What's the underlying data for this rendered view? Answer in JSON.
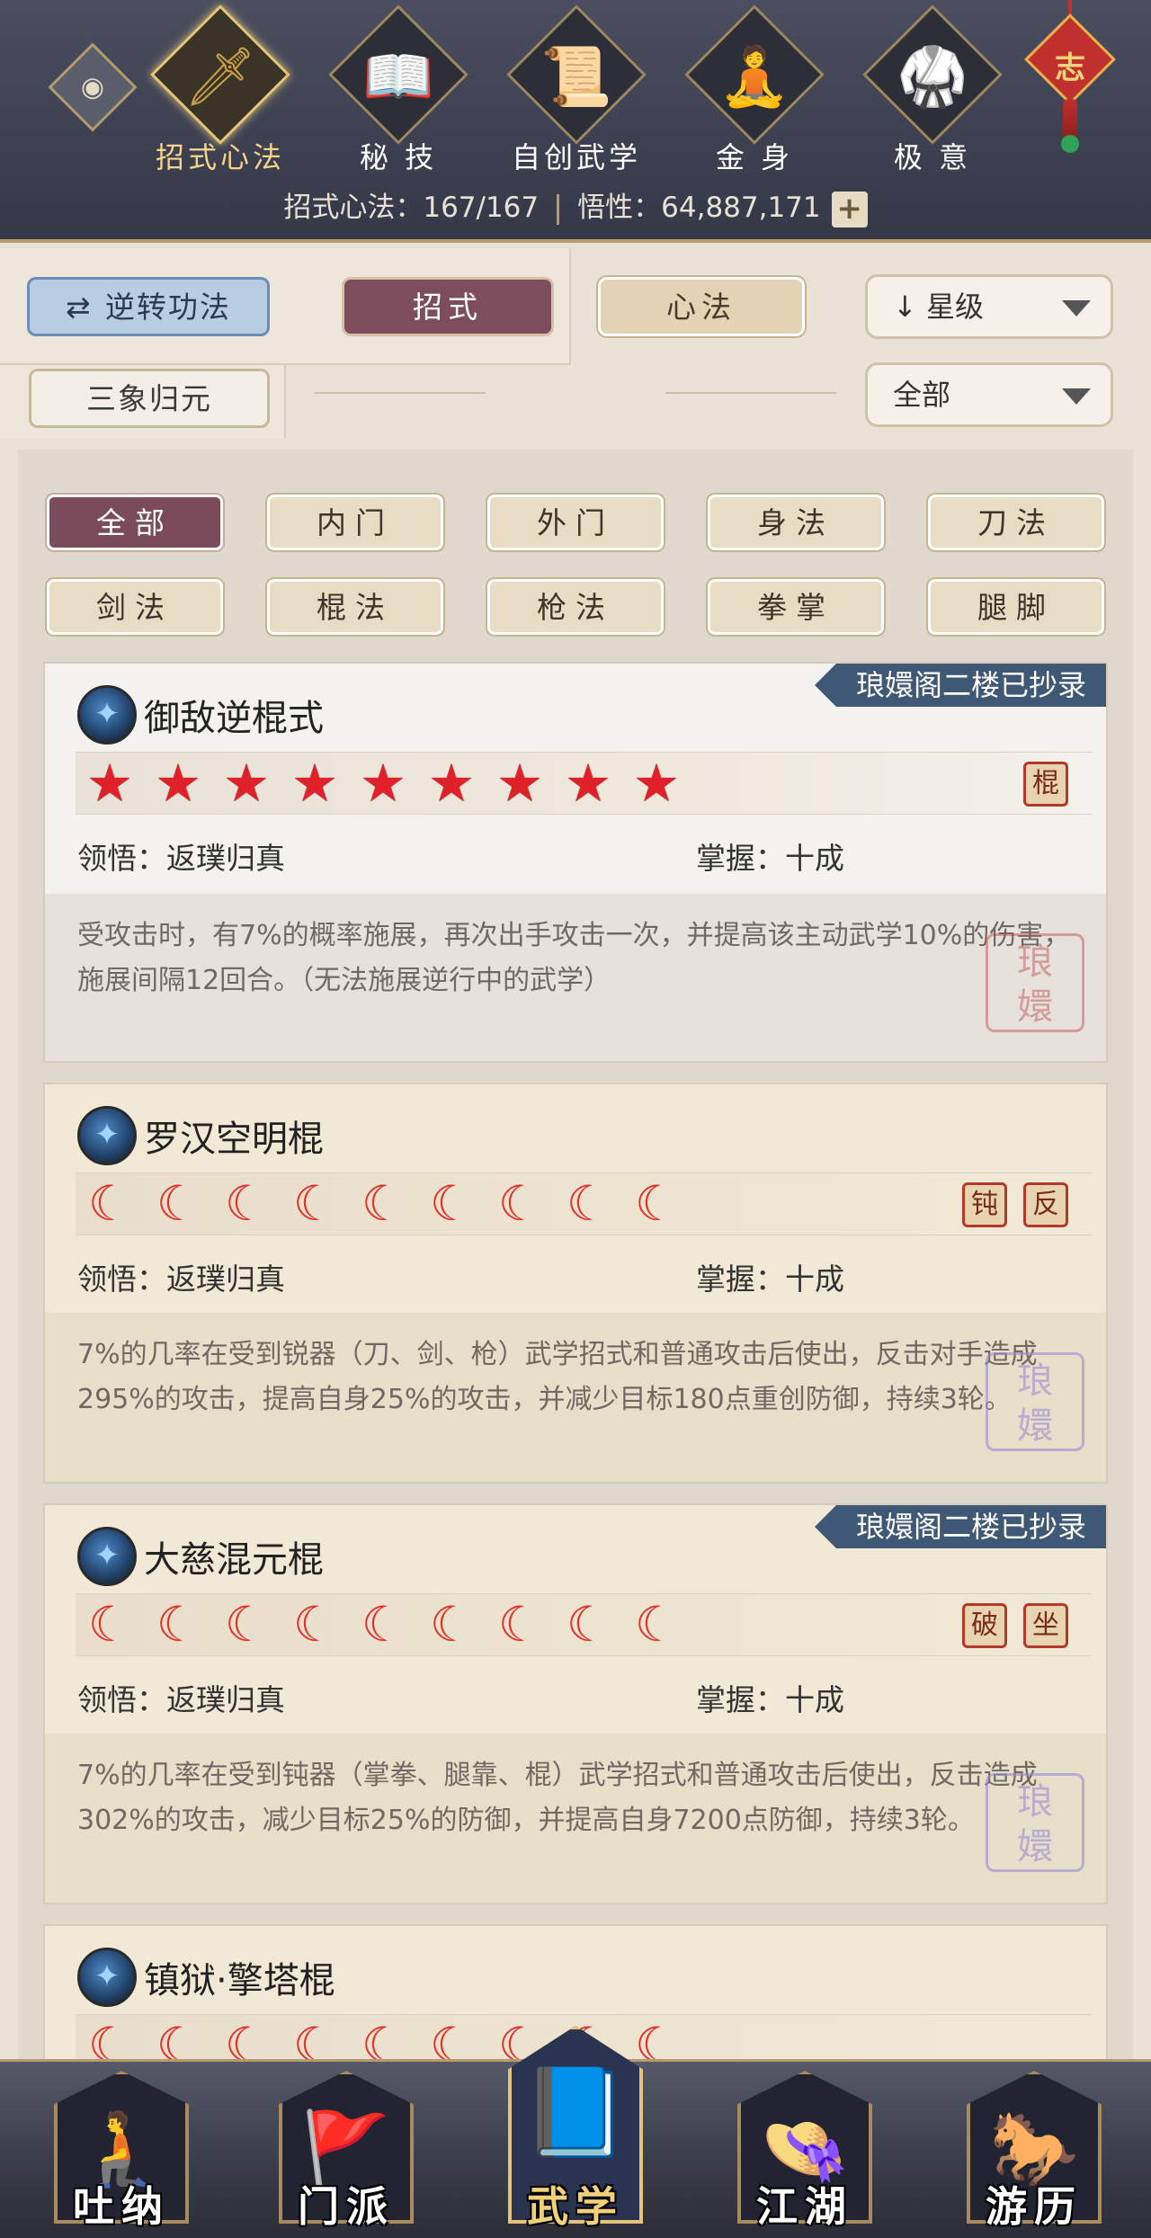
{
  "top_nav": {
    "items": [
      {
        "label": "招式心法",
        "icon": "sword-icon",
        "glyph": "🗡",
        "active": true
      },
      {
        "label": "秘 技",
        "icon": "book-icon",
        "glyph": "📖",
        "active": false
      },
      {
        "label": "自创武学",
        "icon": "scroll-icon",
        "glyph": "📜",
        "active": false
      },
      {
        "label": "金 身",
        "icon": "meditation-icon",
        "glyph": "🧘",
        "active": false
      },
      {
        "label": "极 意",
        "icon": "martial-stance-icon",
        "glyph": "🥋",
        "active": false
      }
    ],
    "charm_text": "志"
  },
  "stats": {
    "moves_label": "招式心法：167/167",
    "insight_label": "悟性：64,887,171",
    "plus": "+"
  },
  "filters": {
    "reverse_button": "逆转功法",
    "reverse_glyph": "⇄",
    "tab_moves": "招式",
    "tab_heart": "心法",
    "sort_dropdown": "↓ 星级",
    "sanxiang_button": "三象归元",
    "scope_dropdown": "全部"
  },
  "categories": [
    "全部",
    "内门",
    "外门",
    "身法",
    "刀法",
    "剑法",
    "棍法",
    "枪法",
    "拳掌",
    "腿脚"
  ],
  "active_category": "全部",
  "cards": [
    {
      "name": "御敌逆棍式",
      "ribbon": "琅嬛阁二楼已抄录",
      "stars": 9,
      "star_type": "star",
      "badges": [
        "棍"
      ],
      "insight": "领悟：返璞归真",
      "mastery": "掌握：十成",
      "desc": "受攻击时，有7%的概率施展，再次出手攻击一次，并提高该主动武学10%的伤害，施展间隔12回合。（无法施展逆行中的武学）"
    },
    {
      "name": "罗汉空明棍",
      "ribbon": "",
      "stars": 9,
      "star_type": "flame",
      "badges": [
        "钝",
        "反"
      ],
      "insight": "领悟：返璞归真",
      "mastery": "掌握：十成",
      "desc": "7%的几率在受到锐器（刀、剑、枪）武学招式和普通攻击后使出，反击对手造成295%的攻击，提高自身25%的攻击，并减少目标180点重创防御，持续3轮。"
    },
    {
      "name": "大慈混元棍",
      "ribbon": "琅嬛阁二楼已抄录",
      "stars": 9,
      "star_type": "flame",
      "badges": [
        "破",
        "坐"
      ],
      "insight": "领悟：返璞归真",
      "mastery": "掌握：十成",
      "desc": "7%的几率在受到钝器（掌拳、腿靠、棍）武学招式和普通攻击后使出，反击造成302%的攻击，减少目标25%的防御，并提高自身7200点防御，持续3轮。"
    },
    {
      "name": "镇狱·擎塔棍",
      "ribbon": "",
      "stars": 9,
      "star_type": "flame",
      "badges": [],
      "insight": "",
      "mastery": "",
      "desc": ""
    }
  ],
  "bottom_nav": {
    "items": [
      {
        "label": "吐纳",
        "icon": "monk-icon",
        "glyph": "🧎",
        "active": false
      },
      {
        "label": "门派",
        "icon": "banner-icon",
        "glyph": "🚩",
        "active": false
      },
      {
        "label": "武学",
        "icon": "manual-icon",
        "glyph": "📘",
        "active": true
      },
      {
        "label": "江湖",
        "icon": "straw-hat-icon",
        "glyph": "👒",
        "active": false
      },
      {
        "label": "游历",
        "icon": "horse-icon",
        "glyph": "🐎",
        "active": false
      }
    ]
  },
  "colors": {
    "topbar": "#3c4050",
    "accent_gold": "#e3c47a",
    "active_tab": "#7b4b5b",
    "ribbon": "#3f5876",
    "star_red": "#e0212a"
  }
}
